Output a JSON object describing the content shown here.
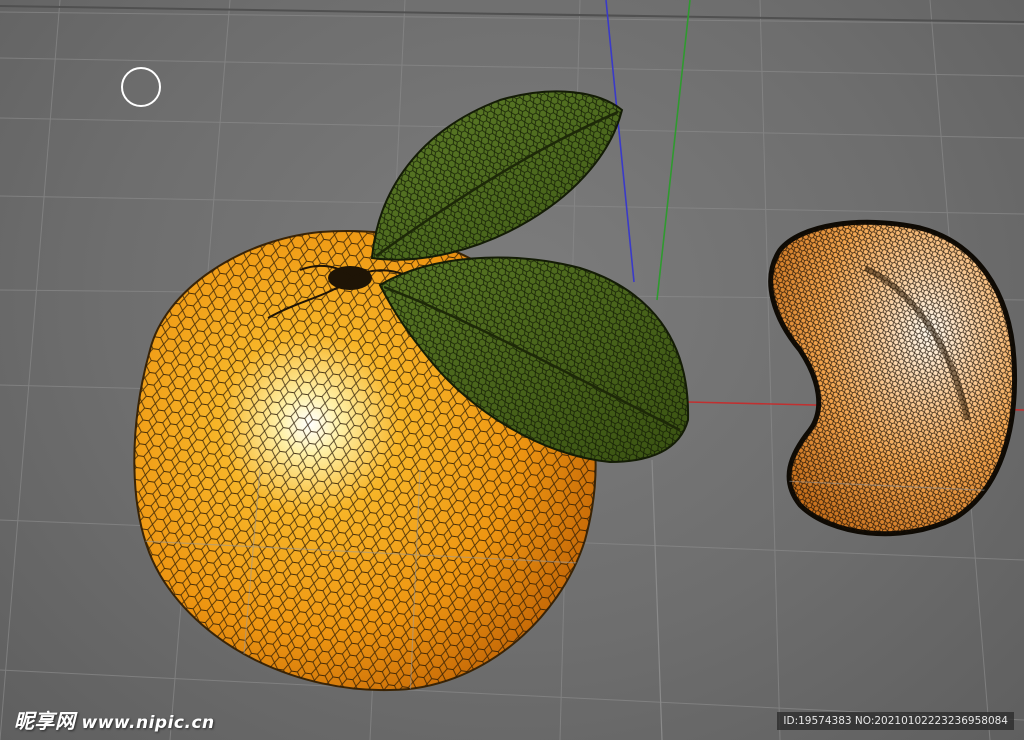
{
  "viewport": {
    "background": "#6f6f6f",
    "grid_color": "#8a8a8a",
    "axis_colors": {
      "x": "#c03030",
      "y": "#2f9a2f",
      "z": "#3a3ac8"
    },
    "cursor_icon": "circle-cursor-icon"
  },
  "objects": {
    "orange": {
      "color": "#f2a11a",
      "highlight": "#ffffff",
      "wire": "#1a1208"
    },
    "leaves": {
      "color": "#4d6a1e",
      "wire": "#1a2208"
    },
    "segment": {
      "color": "#f2ad5a",
      "highlight": "#fff6e6",
      "wire": "#151008"
    }
  },
  "watermark": {
    "logo_text": "昵享网",
    "url": "www.nipic.cn",
    "id_text": "ID:19574383 NO:20210102223236958084"
  }
}
